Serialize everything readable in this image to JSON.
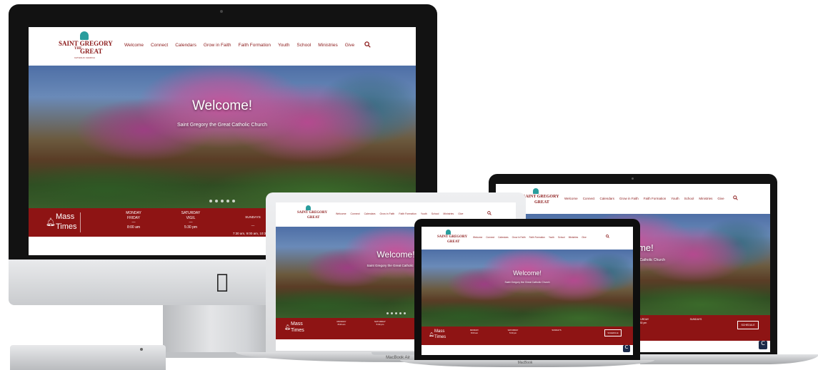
{
  "site": {
    "logo_line1": "SAINT GREGORY",
    "logo_the": "THE",
    "logo_line2": "GREAT",
    "logo_sub": "CATHOLIC CHURCH",
    "search_icon": "search-icon",
    "nav": [
      "Welcome",
      "Connect",
      "Calendars",
      "Grow in Faith",
      "Faith Formation",
      "Youth",
      "School",
      "Ministries",
      "Give"
    ],
    "hero_title": "Welcome!",
    "hero_subtitle": "Saint Gregory the Great Catholic Church",
    "slides": 5,
    "mass_label_1": "Mass",
    "mass_label_2": "Times",
    "bell_icon": "bell-icon",
    "mass_columns": [
      {
        "head": "MONDAY",
        "head2": "FRIDAY",
        "rule": "—",
        "times": "8:00 am"
      },
      {
        "head": "SATURDAY",
        "head2": "VIGIL",
        "rule": "—",
        "times": "5:30 pm"
      },
      {
        "head": "SUNDAYS",
        "head2": "",
        "rule": "—",
        "times": "7:30 am, 9:00 am, 10:30 am\n12:00 pm, 5:00 pm, 6:30 pm"
      }
    ],
    "mass_schedule_button": "SCHEDULE"
  },
  "devices": {
    "imac_logo": "apple-icon",
    "air_label": "MacBook Air",
    "macbook_label": "MacBook"
  },
  "colors": {
    "brand_red": "#8e1414",
    "logo_teal": "#2a9d9d"
  }
}
